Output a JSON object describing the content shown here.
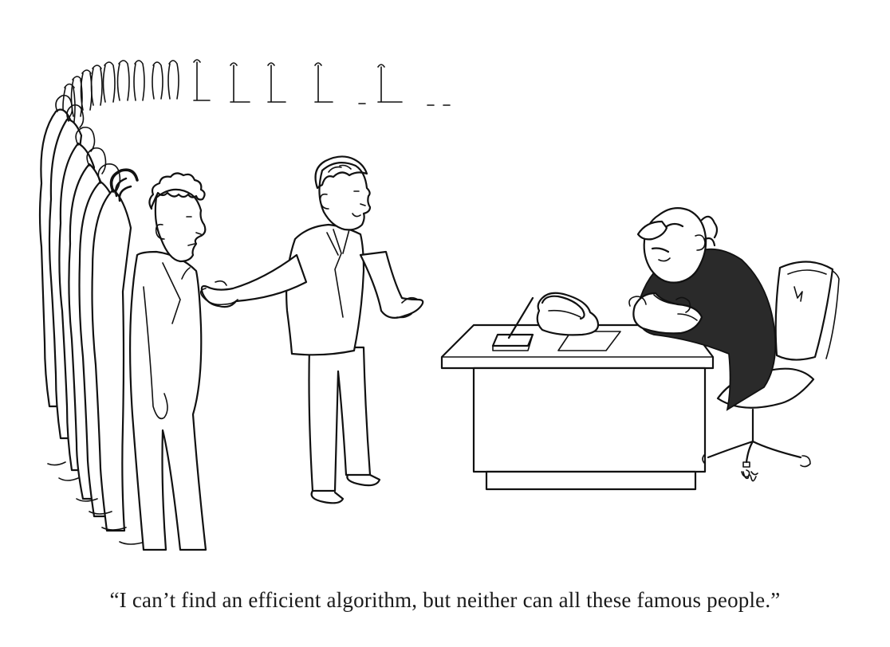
{
  "caption": "“I can’t find an efficient algorithm, but neither can all these famous people.”",
  "colors": {
    "ink": "#111111",
    "paper": "#ffffff",
    "sweater": "#2a2a2a"
  },
  "scene": {
    "queue_figures": 24,
    "elements": [
      "line-of-famous-people",
      "explaining-man",
      "boss-at-desk",
      "desk",
      "telephone",
      "office-chair"
    ]
  }
}
